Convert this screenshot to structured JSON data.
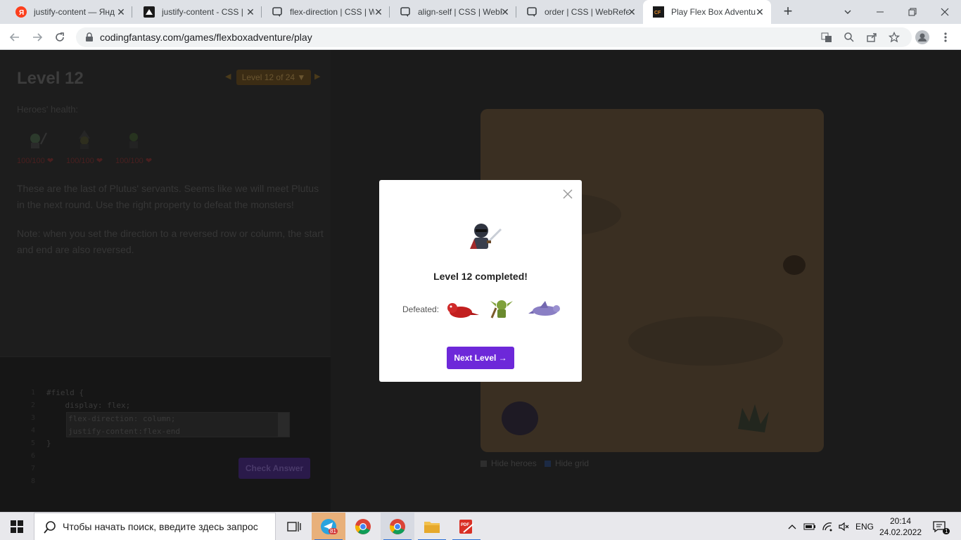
{
  "browser": {
    "tabs": [
      {
        "label": "justify-content — Янд",
        "favicon": "yandex-icon",
        "active": false
      },
      {
        "label": "justify-content - CSS |",
        "favicon": "mdn-icon",
        "active": false
      },
      {
        "label": "flex-direction | CSS | W",
        "favicon": "webref-icon",
        "active": false
      },
      {
        "label": "align-self | CSS | WebR",
        "favicon": "webref-icon",
        "active": false
      },
      {
        "label": "order | CSS | WebRefe",
        "favicon": "webref-icon",
        "active": false
      },
      {
        "label": "Play Flex Box Adventu",
        "favicon": "codingfantasy-icon",
        "active": true
      }
    ],
    "new_tab": "+",
    "url": "codingfantasy.com/games/flexboxadventure/play"
  },
  "game": {
    "level_title": "Level 12",
    "level_select": "Level 12 of 24 ▼",
    "prev_arrow": "◀",
    "next_arrow": "▶",
    "health_label": "Heroes' health:",
    "heroes": [
      {
        "health": "100/100 ❤"
      },
      {
        "health": "100/100 ❤"
      },
      {
        "health": "100/100 ❤"
      }
    ],
    "description_1": "These are the last of Plutus' servants. Seems like we will meet Plutus in the next round. Use the right property to defeat the monsters!",
    "description_2": "Note: when you set the direction to a reversed row or column, the start and end are also reversed.",
    "line_numbers": [
      "1",
      "2",
      "3",
      "4",
      "5",
      "6",
      "7",
      "8"
    ],
    "code_before": "#field {\n    display: flex;",
    "code_input": "flex-direction: column;\njustify-content:flex-end",
    "code_after": "}",
    "check_button": "Check Answer",
    "hide_heroes": "Hide heroes",
    "hide_grid": "Hide grid"
  },
  "modal": {
    "title": "Level 12 completed!",
    "defeated_label": "Defeated:",
    "next_button": "Next Level →"
  },
  "taskbar": {
    "search_placeholder": "Чтобы начать поиск, введите здесь запрос",
    "telegram_badge": "81",
    "language": "ENG",
    "time": "20:14",
    "date": "24.02.2022",
    "notification_count": "1"
  },
  "colors": {
    "accent": "#6d28d9",
    "field": "#3a2f22"
  }
}
